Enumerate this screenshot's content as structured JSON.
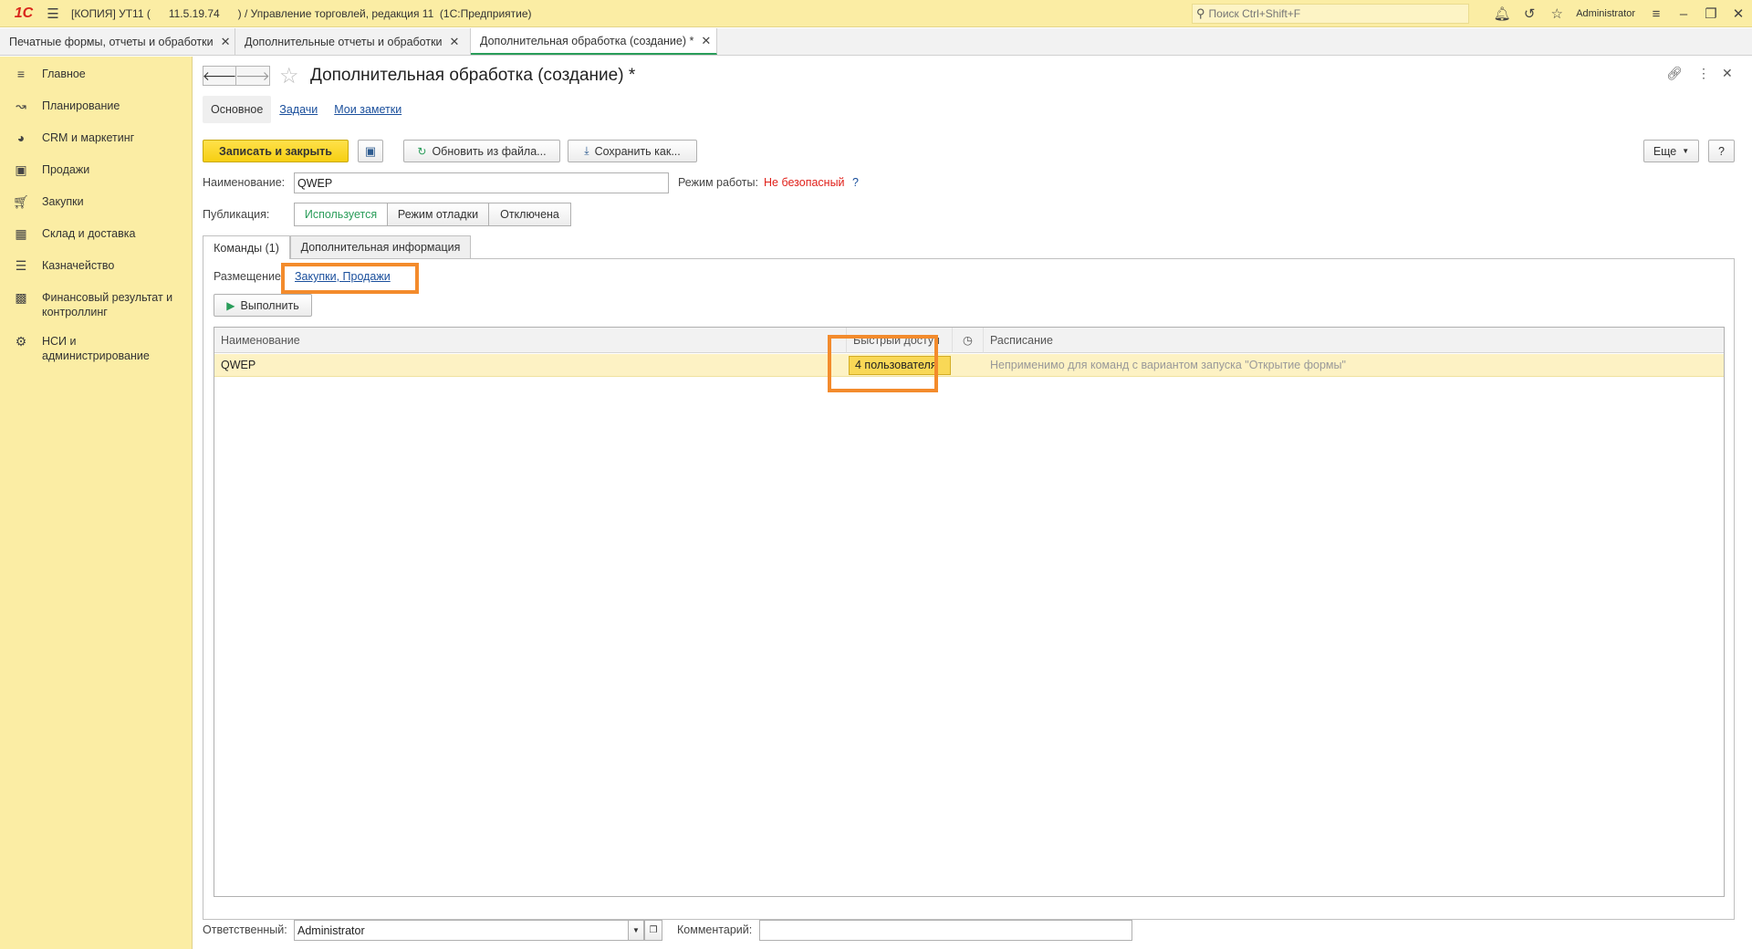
{
  "titlebar": {
    "logo": "1С",
    "title": "[КОПИЯ] УТ11 (      11.5.19.74      ) / Управление торговлей, редакция 11  (1С:Предприятие)",
    "search_placeholder": "Поиск Ctrl+Shift+F",
    "user": "Administrator"
  },
  "tabs": [
    {
      "label": "Печатные формы, отчеты и обработки"
    },
    {
      "label": "Дополнительные отчеты и обработки"
    },
    {
      "label": "Дополнительная обработка (создание) *"
    }
  ],
  "sidebar": {
    "items": [
      {
        "label": "Главное",
        "icon": "menu-icon"
      },
      {
        "label": "Планирование",
        "icon": "chart-icon"
      },
      {
        "label": "CRM и маркетинг",
        "icon": "pie-icon"
      },
      {
        "label": "Продажи",
        "icon": "bag-icon"
      },
      {
        "label": "Закупки",
        "icon": "cart-icon"
      },
      {
        "label": "Склад и доставка",
        "icon": "warehouse-icon"
      },
      {
        "label": "Казначейство",
        "icon": "coins-icon"
      },
      {
        "label": "Финансовый результат и контроллинг",
        "icon": "bars-icon"
      },
      {
        "label": "НСИ и администрирование",
        "icon": "gear-icon"
      }
    ]
  },
  "form": {
    "title": "Дополнительная обработка (создание) *",
    "sections": [
      "Основное",
      "Задачи",
      "Мои заметки"
    ],
    "buttons": {
      "save_close": "Записать и закрыть",
      "update_from_file": "Обновить из файла...",
      "save_as": "Сохранить как...",
      "more": "Еще",
      "help": "?",
      "execute": "Выполнить"
    },
    "name_label": "Наименование:",
    "name_value": "QWEP",
    "mode_label": "Режим работы:",
    "mode_value": "Не безопасный",
    "mode_help": "?",
    "publication_label": "Публикация:",
    "publication_options": [
      "Используется",
      "Режим отладки",
      "Отключена"
    ],
    "publication_selected": "Используется",
    "inner_tabs": [
      "Команды (1)",
      "Дополнительная информация"
    ],
    "placement_label": "Размещение:",
    "placement_value": "Закупки, Продажи",
    "table": {
      "columns": [
        "Наименование",
        "Быстрый доступ",
        "Расписание"
      ],
      "rows": [
        {
          "name": "QWEP",
          "quick_access": "4 пользователя",
          "schedule": "Неприменимо для команд с вариантом запуска \"Открытие формы\""
        }
      ]
    },
    "responsible_label": "Ответственный:",
    "responsible_value": "Administrator",
    "comment_label": "Комментарий:",
    "comment_value": ""
  },
  "colors": {
    "panel_yellow": "#fbeda4",
    "primary_button": "#f6cf12",
    "highlight_orange": "#f38b2c",
    "active_green": "#2a9d5a",
    "warning_red": "#e0201a",
    "link_blue": "#1a4f9c"
  }
}
